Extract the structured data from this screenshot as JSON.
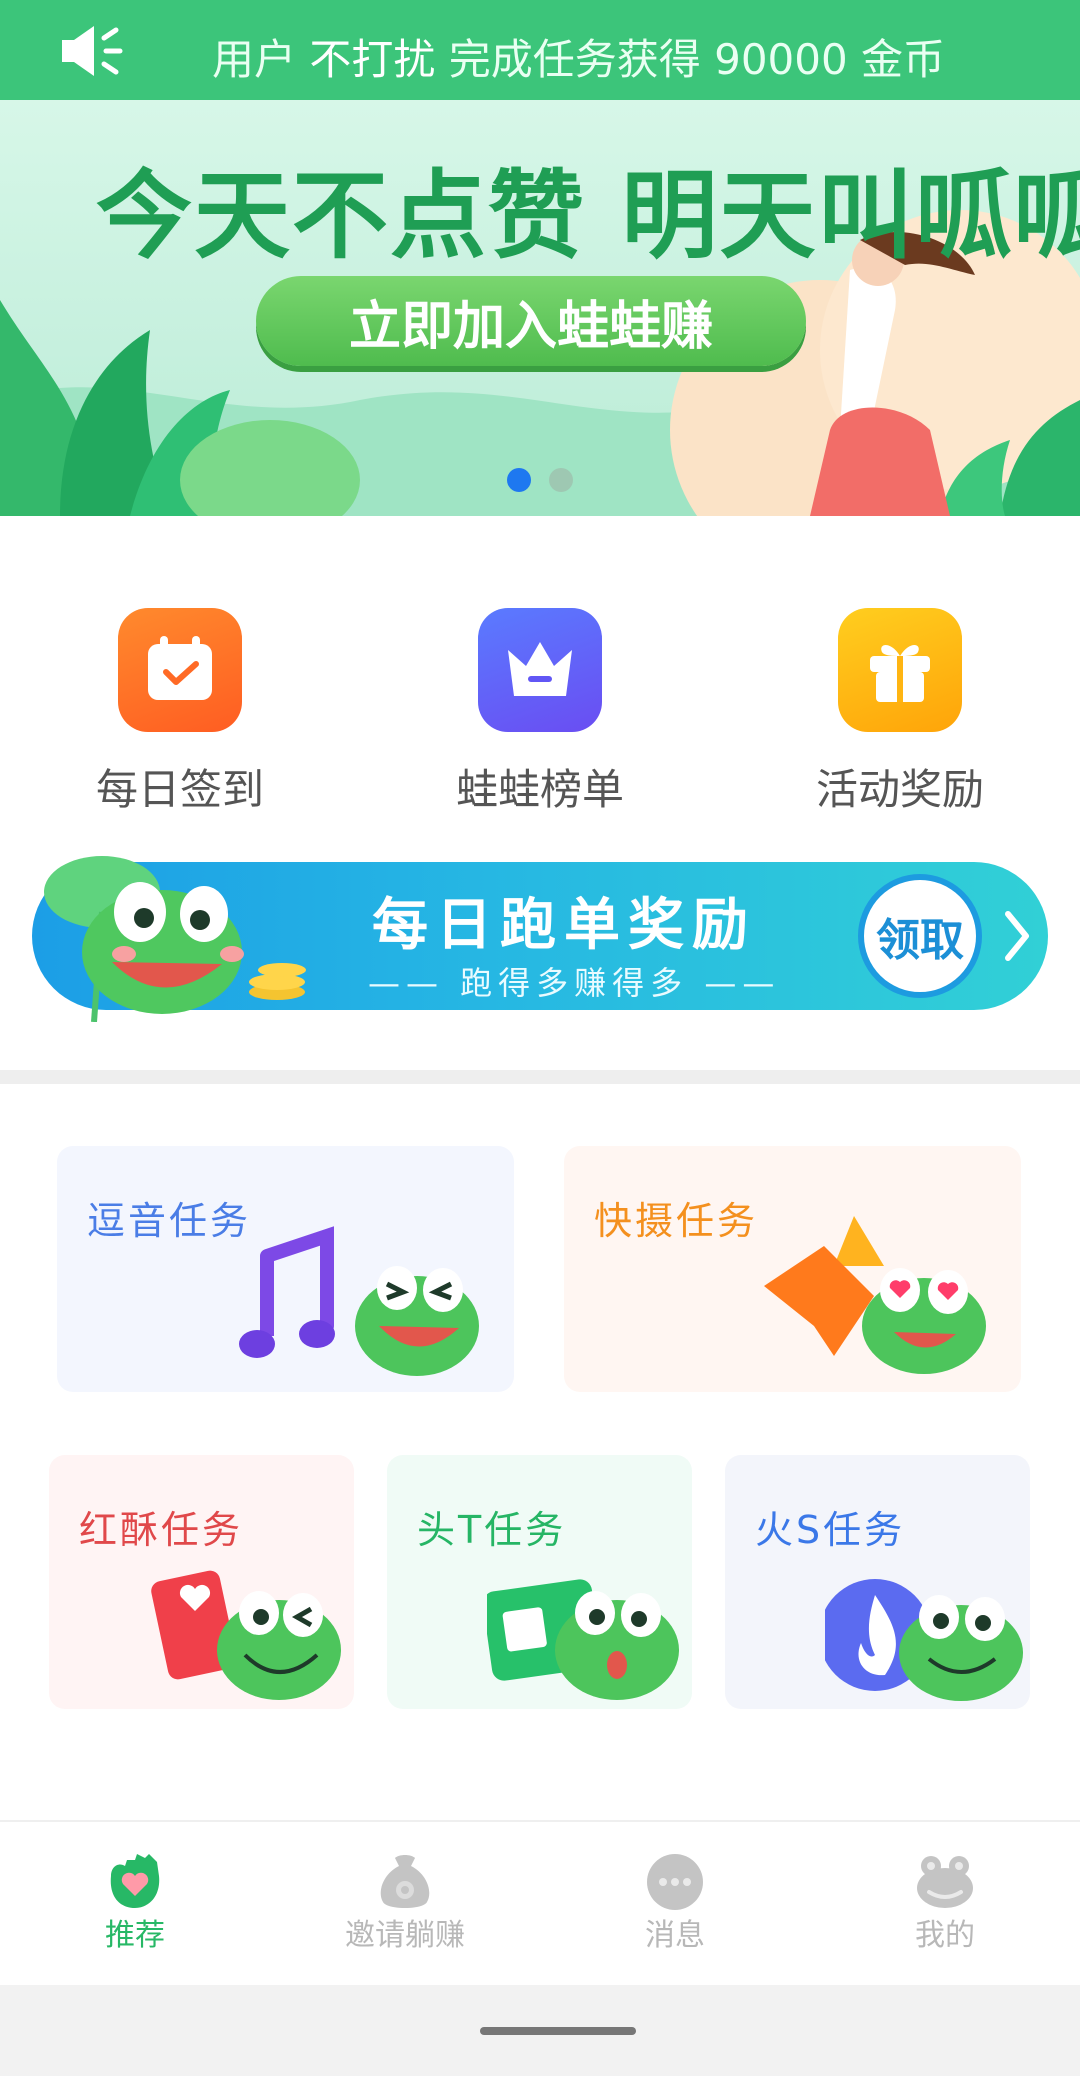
{
  "notice": {
    "icon": "speaker-icon",
    "prefix": "用户",
    "user": "不打扰",
    "message": "完成任务获得 90000 金币"
  },
  "banner": {
    "headline": "今天不点赞  明天叫呱呱",
    "cta": "立即加入蛙蛙赚",
    "slides": 2,
    "active_slide": 1
  },
  "quick_entries": [
    {
      "label": "每日签到",
      "icon": "calendar-check-icon",
      "color": "#ff6a25"
    },
    {
      "label": "蛙蛙榜单",
      "icon": "crown-icon",
      "color": "#6156f5"
    },
    {
      "label": "活动奖励",
      "icon": "gift-icon",
      "color": "#ffb512"
    }
  ],
  "run_banner": {
    "title": "每日跑单奖励",
    "subtitle": "—— 跑得多赚得多 ——",
    "claim": "领取"
  },
  "tasks": [
    {
      "label": "逗音任务",
      "icon": "music-note-icon"
    },
    {
      "label": "快摄任务",
      "icon": "chat-bubble-icon"
    },
    {
      "label": "红酥任务",
      "icon": "heart-book-icon"
    },
    {
      "label": "头T任务",
      "icon": "news-icon"
    },
    {
      "label": "火S任务",
      "icon": "flame-icon"
    }
  ],
  "tabs": [
    {
      "label": "推荐",
      "icon": "frog-hand-heart-icon",
      "active": true
    },
    {
      "label": "邀请躺赚",
      "icon": "money-bag-icon",
      "active": false
    },
    {
      "label": "消息",
      "icon": "message-icon",
      "active": false
    },
    {
      "label": "我的",
      "icon": "frog-face-icon",
      "active": false
    }
  ],
  "colors": {
    "brand_green": "#3cc57a",
    "tab_active": "#27b866",
    "tab_inactive": "#b8b8b8"
  }
}
